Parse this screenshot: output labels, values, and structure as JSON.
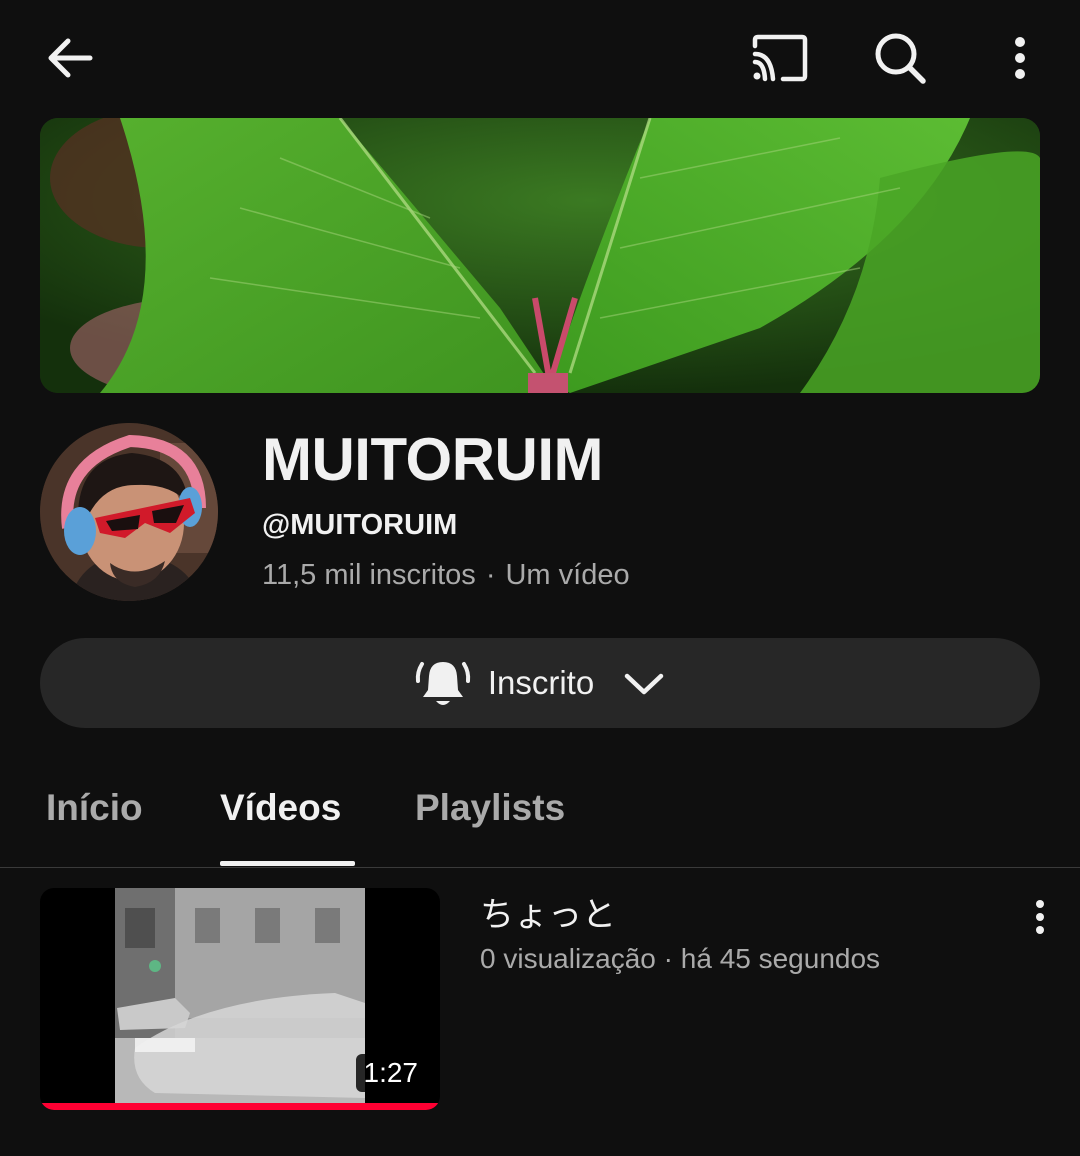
{
  "topbar": {
    "back_icon": "arrow-left-icon",
    "cast_icon": "cast-icon",
    "search_icon": "search-icon",
    "more_icon": "more-vertical-icon"
  },
  "channel": {
    "name": "MUITORUIM",
    "handle": "@MUITORUIM",
    "subscribers": "11,5 mil inscritos",
    "separator": "·",
    "video_count": "Um vídeo"
  },
  "subscribe": {
    "label": "Inscrito",
    "bell_icon": "bell-ringing-icon",
    "chevron_icon": "chevron-down-icon"
  },
  "tabs": [
    {
      "label": "Início",
      "active": false
    },
    {
      "label": "Vídeos",
      "active": true
    },
    {
      "label": "Playlists",
      "active": false
    }
  ],
  "videos": [
    {
      "title": "ちょっと",
      "views": "0 visualização",
      "separator": "·",
      "age": "há 45 segundos",
      "duration": "1:27",
      "watched_fraction": 1.0
    }
  ],
  "colors": {
    "background": "#0f0f0f",
    "button_bg": "#272727",
    "secondary_text": "#aaaaaa",
    "progress": "#ff0033"
  }
}
